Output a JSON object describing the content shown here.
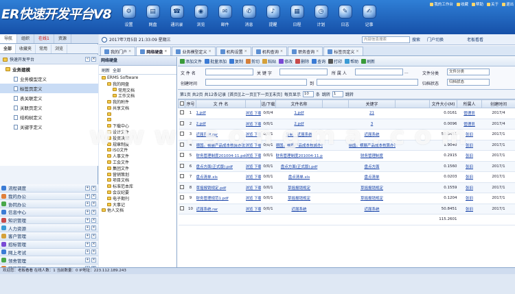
{
  "header": {
    "logo": "ER快速开发平台V8",
    "nav": [
      {
        "label": "设置",
        "icon": "gear-icon",
        "glyph": "⚙"
      },
      {
        "label": "网盘",
        "icon": "disk-icon",
        "glyph": "▤"
      },
      {
        "label": "通讯录",
        "icon": "contacts-icon",
        "glyph": "☎"
      },
      {
        "label": "浏览",
        "icon": "browser-icon",
        "glyph": "◉"
      },
      {
        "label": "邮件",
        "icon": "mail-icon",
        "glyph": "✉"
      },
      {
        "label": "消息",
        "icon": "message-icon",
        "glyph": "✆"
      },
      {
        "label": "提醒",
        "icon": "reminder-icon",
        "glyph": "♪"
      },
      {
        "label": "日程",
        "icon": "calendar-icon",
        "glyph": "▦"
      },
      {
        "label": "计划",
        "icon": "plan-icon",
        "glyph": "◷"
      },
      {
        "label": "日志",
        "icon": "log-icon",
        "glyph": "✎"
      },
      {
        "label": "记事",
        "icon": "note-icon",
        "glyph": "✍"
      }
    ],
    "toplinks": [
      "我的工作台",
      "收藏",
      "帮助",
      "关于",
      "退出"
    ]
  },
  "sidebar": {
    "tabs": [
      "导航",
      "组织",
      "在线1",
      "资源"
    ],
    "subtabs": [
      "全部",
      "收藏夹",
      "常用",
      "浏览"
    ],
    "tree_title": "快速开发平台",
    "tree": [
      {
        "label": "业务建模",
        "level": 1
      },
      {
        "label": "业务模型定义",
        "level": 2
      },
      {
        "label": "标签页定义",
        "level": 2,
        "selected": true
      },
      {
        "label": "表关联定义",
        "level": 2
      },
      {
        "label": "关联页定义",
        "level": 2
      },
      {
        "label": "结构树定义",
        "level": 2
      },
      {
        "label": "关键字定义",
        "level": 2
      }
    ],
    "menu": [
      {
        "label": "流程调度",
        "color": "#3a7bd5"
      },
      {
        "label": "我的办公",
        "color": "#e0803a"
      },
      {
        "label": "协同办公",
        "color": "#4aa84a"
      },
      {
        "label": "信息中心",
        "color": "#3a7bd5"
      },
      {
        "label": "知识管理",
        "color": "#c84a4a"
      },
      {
        "label": "人力资源",
        "color": "#3a9bd5"
      },
      {
        "label": "客户管理",
        "color": "#d5a13a"
      },
      {
        "label": "招标管理",
        "color": "#7a4ad5"
      },
      {
        "label": "网上考试",
        "color": "#3a7bd5"
      },
      {
        "label": "领舍管理",
        "color": "#4aa84a"
      },
      {
        "label": "项目管理",
        "color": "#e0803a"
      }
    ]
  },
  "infobar": {
    "datetime": "2017年7月5日 21:33:09 星期三",
    "search_placeholder": "内部信息搜索",
    "search_label": "搜索",
    "portal_label": "门户切换",
    "user_label": "老板看看"
  },
  "tabs": [
    {
      "label": "我的门户",
      "active": false
    },
    {
      "label": "网络硬盘",
      "active": true
    },
    {
      "label": "业务模型定义",
      "active": false
    },
    {
      "label": "机构设置",
      "active": false
    },
    {
      "label": "机构查询",
      "active": false
    },
    {
      "label": "职务查询",
      "active": false
    },
    {
      "label": "标签页定义",
      "active": false
    }
  ],
  "filetree": {
    "title": "网络硬盘",
    "tool": [
      "刷新",
      "全部"
    ],
    "nodes": [
      {
        "label": "ERMS Software",
        "indent": 0
      },
      {
        "label": "我的网盘",
        "indent": 1
      },
      {
        "label": "常用文档",
        "indent": 2
      },
      {
        "label": "工作文档",
        "indent": 2
      },
      {
        "label": "我的附件",
        "indent": 1
      },
      {
        "label": "共享文档",
        "indent": 1
      },
      {
        "label": "",
        "indent": 1
      },
      {
        "label": "",
        "indent": 1
      },
      {
        "label": "下载中心",
        "indent": 1
      },
      {
        "label": "设计文件",
        "indent": 1
      },
      {
        "label": "投资决策",
        "indent": 1
      },
      {
        "label": "规章制度",
        "indent": 1
      },
      {
        "label": "ISO文件",
        "indent": 1
      },
      {
        "label": "人事文件",
        "indent": 1
      },
      {
        "label": "工会文件",
        "indent": 1
      },
      {
        "label": "集团文件",
        "indent": 1
      },
      {
        "label": "营销策划",
        "indent": 1
      },
      {
        "label": "项目文档",
        "indent": 1
      },
      {
        "label": "标准范本库",
        "indent": 1
      },
      {
        "label": "会议纪要",
        "indent": 1
      },
      {
        "label": "电子期刊",
        "indent": 1
      },
      {
        "label": "大事记",
        "indent": 1
      },
      {
        "label": "他人文档",
        "indent": 0
      }
    ]
  },
  "toolbar": [
    "添加文件",
    "批量添加",
    "复制",
    "剪切",
    "粘贴",
    "修改",
    "删除",
    "查询",
    "打印",
    "帮助",
    "刷新"
  ],
  "form": {
    "file_name": "文 件 名",
    "keyword": "关 键 字",
    "owner": "所 属 人",
    "owner_btn": "...",
    "category": "文件分类",
    "category_value": "文件分类",
    "created": "创建时间",
    "to": "到",
    "archive": "归档状态",
    "archive_value": "归档状态"
  },
  "pager": {
    "text": "第1页 共2页 共12条记录",
    "nav": "[首页][上一页][下一页][末页]",
    "per_page_label": "每页显示",
    "per_page": "10",
    "unit": "条",
    "jump_label": "跳转",
    "page": "1",
    "jump_btn": "跳转"
  },
  "table": {
    "headers": [
      "",
      "序号",
      "文 件 名",
      "",
      "送/下载",
      "文件名称",
      "",
      "关键字",
      "",
      "文件大小(M)",
      "所属人",
      "创建时间"
    ],
    "rows": [
      {
        "no": "1",
        "name": "1.pdf",
        "dl": "浏览  下载",
        "cnt": "0/0/4",
        "fname": "1.pdf",
        "kw": "21",
        "size": "0.0161",
        "owner": "管理员",
        "date": "2017/4"
      },
      {
        "no": "2",
        "name": "2.pdf",
        "dl": "浏览  下载",
        "cnt": "0/0/1",
        "fname": "2.pdf",
        "kw": "3",
        "size": "0.0096",
        "owner": "管理员",
        "date": "2017/4"
      },
      {
        "no": "3",
        "name": "近届系统.rar",
        "dl": "浏览  下载",
        "cnt": "0/0/1",
        "fname": "复制 - 近届系统",
        "kw": "近届系统",
        "size": "50.8451",
        "owner": "张旧",
        "date": "2017/1"
      },
      {
        "no": "4",
        "name": "德国。横展产品成本核算办法1.rar",
        "dl": "浏览  下载",
        "cnt": "0/0/1",
        "fname": "德国。横展产品成本核算办法1.rar",
        "kw": "德国。横展产品成本核算办法",
        "size": "1.9040",
        "owner": "张旧",
        "date": "2017/1"
      },
      {
        "no": "5",
        "name": "财务管理制度201004-11.pdf",
        "dl": "浏览  下载",
        "cnt": "0/0/1",
        "fname": "财务管理制度201004-11.pdf",
        "kw": "财务管理制度",
        "size": "0.2915",
        "owner": "张旧",
        "date": "2017/1"
      },
      {
        "no": "6",
        "name": "盘点方面(正式版).pdf",
        "dl": "浏览  下载",
        "cnt": "0/0/1",
        "fname": "盘点方面(正式版).pdf",
        "kw": "盘点方面",
        "size": "0.1560",
        "owner": "张旧",
        "date": "2017/1"
      },
      {
        "no": "7",
        "name": "盘点清单.xls",
        "dl": "浏览  下载",
        "cnt": "0/0/1",
        "fname": "盘点清单.xls",
        "kw": "盘点清单",
        "size": "0.0203",
        "owner": "张旧",
        "date": "2017/1"
      },
      {
        "no": "8",
        "name": "草摇报销规定.pdf",
        "dl": "浏览  下载",
        "cnt": "0/0/1",
        "fname": "草摇报销规定",
        "kw": "草摇报销规定",
        "size": "0.1559",
        "owner": "张旧",
        "date": "2017/1"
      },
      {
        "no": "9",
        "name": "财务管理规范1.pdf",
        "dl": "浏览  下载",
        "cnt": "0/0/1",
        "fname": "草摇报销规定",
        "kw": "草摇报销规定",
        "size": "0.1204",
        "owner": "张旧",
        "date": "2017/1"
      },
      {
        "no": "10",
        "name": "近届系统.rar",
        "dl": "浏览  下载",
        "cnt": "0/0/1",
        "fname": "近届系统",
        "kw": "近届系统",
        "size": "50.8451",
        "owner": "张旧",
        "date": "2017/1"
      }
    ],
    "total": "115.2601"
  },
  "status": "欢迎您：老板看看   在线人数：1  当前数量：0  IP地址：223.112.189.243",
  "watermark": "www.songma.com"
}
